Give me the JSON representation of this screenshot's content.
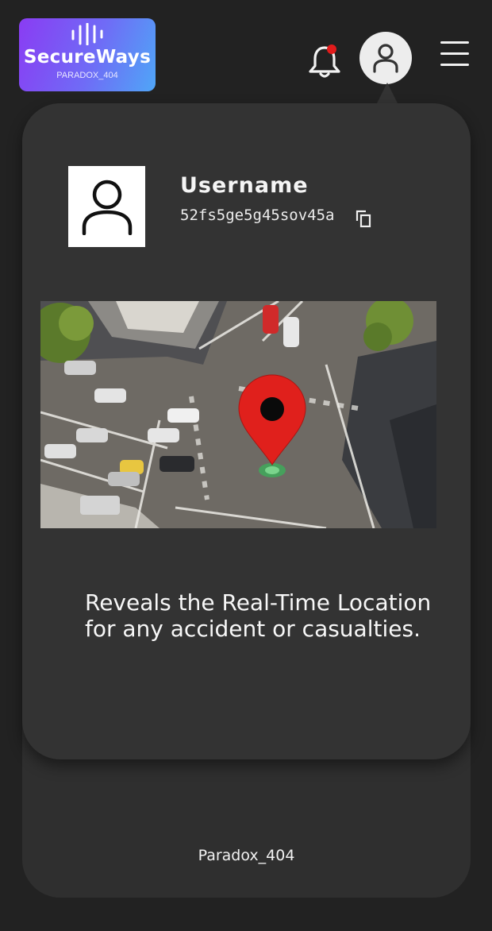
{
  "header": {
    "logo": {
      "title": "SecureWays",
      "subtitle": "PARADOX_404"
    },
    "notification": {
      "icon": "bell-icon",
      "has_unread": true,
      "dot_color": "#e21b1b"
    },
    "profile_button": {
      "icon": "user-icon"
    },
    "menu_button": {
      "icon": "hamburger-icon"
    }
  },
  "profile_card": {
    "avatar_icon": "user-icon",
    "username": "Username",
    "user_id": "52fs5ge5g45sov45a",
    "copy_icon": "copy-icon",
    "map_image": {
      "icon": "location-pin-icon",
      "alt": "aerial street intersection with location pin"
    },
    "description": "Reveals the Real-Time Location for any accident or casualties."
  },
  "footer": {
    "text": "Paradox_404"
  },
  "colors": {
    "background": "#222222",
    "panel": "#2f2f2f",
    "card": "#333333",
    "logo_gradient_start": "#8a3cf3",
    "logo_gradient_end": "#4fa6f7",
    "pin": "#e0201c"
  }
}
